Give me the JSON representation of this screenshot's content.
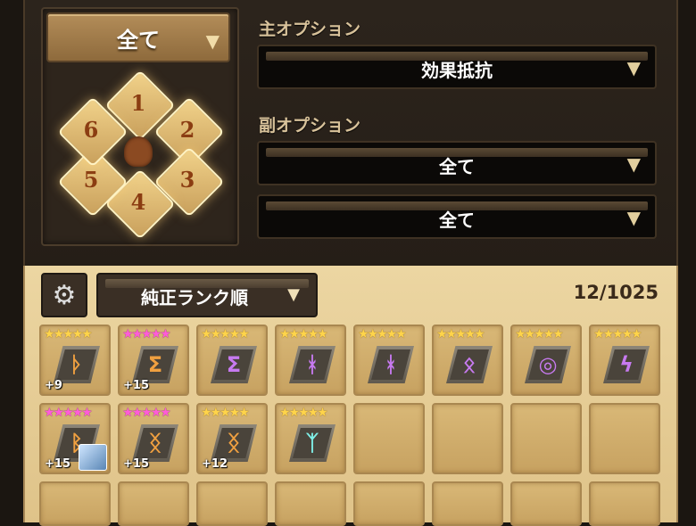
{
  "set_filter": {
    "value": "全て"
  },
  "slots": [
    "1",
    "2",
    "3",
    "4",
    "5",
    "6"
  ],
  "main_option": {
    "label": "主オプション",
    "value": "効果抵抗"
  },
  "sub_option": {
    "label": "副オプション",
    "values": [
      "全て",
      "全て"
    ]
  },
  "sort": {
    "value": "純正ランク順"
  },
  "rune_count": "12/1025",
  "colors": {
    "orange": "#f0a040",
    "purple": "#c77af0",
    "cyan": "#7ff0e8"
  },
  "runes": [
    {
      "stars": "★★★★★",
      "star_color": "gold",
      "glyph": "ᚦ",
      "glyph_color": "#f0a040",
      "level": "+9",
      "monster": false
    },
    {
      "stars": "★★★★★",
      "star_color": "pink",
      "glyph": "Σ",
      "glyph_color": "#f0a040",
      "level": "+15",
      "monster": false
    },
    {
      "stars": "★★★★★",
      "star_color": "gold",
      "glyph": "Σ",
      "glyph_color": "#c77af0",
      "level": "",
      "monster": false
    },
    {
      "stars": "★★★★★",
      "star_color": "gold",
      "glyph": "ᚼ",
      "glyph_color": "#c77af0",
      "level": "",
      "monster": false
    },
    {
      "stars": "★★★★★",
      "star_color": "gold",
      "glyph": "ᚼ",
      "glyph_color": "#c77af0",
      "level": "",
      "monster": false
    },
    {
      "stars": "★★★★★",
      "star_color": "gold",
      "glyph": "ᛟ",
      "glyph_color": "#c77af0",
      "level": "",
      "monster": false
    },
    {
      "stars": "★★★★★",
      "star_color": "gold",
      "glyph": "◎",
      "glyph_color": "#c77af0",
      "level": "",
      "monster": false
    },
    {
      "stars": "★★★★★",
      "star_color": "gold",
      "glyph": "ϟ",
      "glyph_color": "#c77af0",
      "level": "",
      "monster": false
    },
    {
      "stars": "★★★★★",
      "star_color": "pink",
      "glyph": "ᛒ",
      "glyph_color": "#f0a040",
      "level": "+15",
      "monster": true
    },
    {
      "stars": "★★★★★",
      "star_color": "pink",
      "glyph": "ᛝ",
      "glyph_color": "#f0a040",
      "level": "+15",
      "monster": false
    },
    {
      "stars": "★★★★★",
      "star_color": "gold",
      "glyph": "ᛝ",
      "glyph_color": "#f0a040",
      "level": "+12",
      "monster": false
    },
    {
      "stars": "★★★★★",
      "star_color": "gold",
      "glyph": "ᛉ",
      "glyph_color": "#7ff0e8",
      "level": "",
      "monster": false
    }
  ]
}
